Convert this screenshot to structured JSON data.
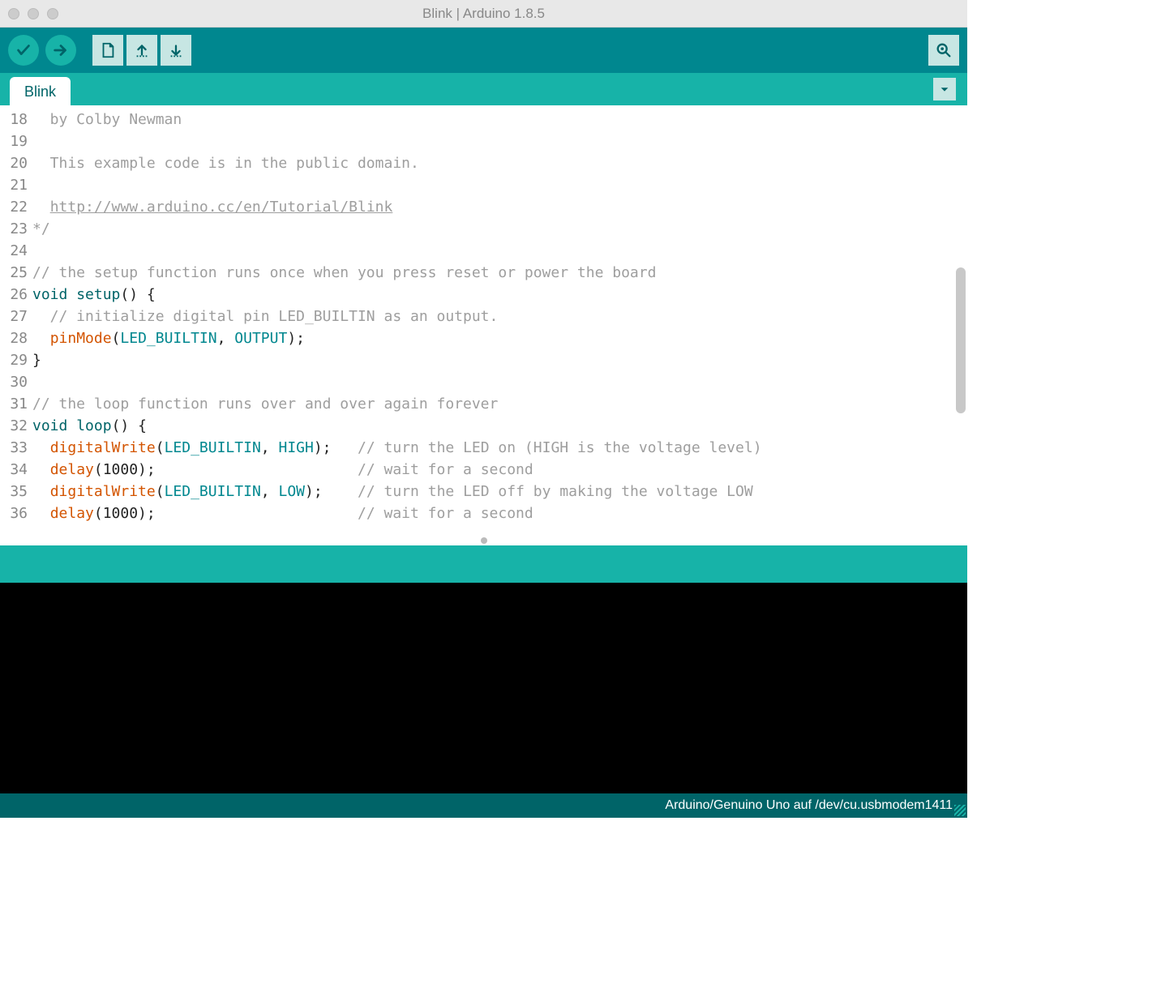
{
  "window": {
    "title": "Blink | Arduino 1.8.5"
  },
  "toolbar": {
    "verify": "Verify",
    "upload": "Upload",
    "new": "New",
    "open": "Open",
    "save": "Save",
    "serial": "Serial Monitor"
  },
  "tabs": {
    "active": "Blink"
  },
  "editor": {
    "first_line": 18,
    "lines": [
      {
        "n": 18,
        "tokens": [
          {
            "t": "  by Colby Newman",
            "c": "c-comment"
          }
        ]
      },
      {
        "n": 19,
        "tokens": []
      },
      {
        "n": 20,
        "tokens": [
          {
            "t": "  This example code is in the public domain.",
            "c": "c-comment"
          }
        ]
      },
      {
        "n": 21,
        "tokens": []
      },
      {
        "n": 22,
        "tokens": [
          {
            "t": "  ",
            "c": "c-comment"
          },
          {
            "t": "http://www.arduino.cc/en/Tutorial/Blink",
            "c": "c-link"
          }
        ]
      },
      {
        "n": 23,
        "tokens": [
          {
            "t": "*/",
            "c": "c-comment"
          }
        ]
      },
      {
        "n": 24,
        "tokens": []
      },
      {
        "n": 25,
        "tokens": [
          {
            "t": "// the setup function runs once when you press reset or power the board",
            "c": "c-comment"
          }
        ]
      },
      {
        "n": 26,
        "tokens": [
          {
            "t": "void",
            "c": "c-type"
          },
          {
            "t": " "
          },
          {
            "t": "setup",
            "c": "c-type"
          },
          {
            "t": "() {"
          }
        ]
      },
      {
        "n": 27,
        "tokens": [
          {
            "t": "  // initialize digital pin LED_BUILTIN as an output.",
            "c": "c-comment"
          }
        ]
      },
      {
        "n": 28,
        "tokens": [
          {
            "t": "  "
          },
          {
            "t": "pinMode",
            "c": "c-func"
          },
          {
            "t": "("
          },
          {
            "t": "LED_BUILTIN",
            "c": "c-const"
          },
          {
            "t": ", "
          },
          {
            "t": "OUTPUT",
            "c": "c-const"
          },
          {
            "t": ");"
          }
        ]
      },
      {
        "n": 29,
        "tokens": [
          {
            "t": "}"
          }
        ]
      },
      {
        "n": 30,
        "tokens": []
      },
      {
        "n": 31,
        "tokens": [
          {
            "t": "// the loop function runs over and over again forever",
            "c": "c-comment"
          }
        ]
      },
      {
        "n": 32,
        "tokens": [
          {
            "t": "void",
            "c": "c-type"
          },
          {
            "t": " "
          },
          {
            "t": "loop",
            "c": "c-type"
          },
          {
            "t": "() {"
          }
        ]
      },
      {
        "n": 33,
        "tokens": [
          {
            "t": "  "
          },
          {
            "t": "digitalWrite",
            "c": "c-func"
          },
          {
            "t": "("
          },
          {
            "t": "LED_BUILTIN",
            "c": "c-const"
          },
          {
            "t": ", "
          },
          {
            "t": "HIGH",
            "c": "c-const"
          },
          {
            "t": ");   "
          },
          {
            "t": "// turn the LED on (HIGH is the voltage level)",
            "c": "c-comment"
          }
        ]
      },
      {
        "n": 34,
        "tokens": [
          {
            "t": "  "
          },
          {
            "t": "delay",
            "c": "c-func"
          },
          {
            "t": "(1000);                       "
          },
          {
            "t": "// wait for a second",
            "c": "c-comment"
          }
        ]
      },
      {
        "n": 35,
        "tokens": [
          {
            "t": "  "
          },
          {
            "t": "digitalWrite",
            "c": "c-func"
          },
          {
            "t": "("
          },
          {
            "t": "LED_BUILTIN",
            "c": "c-const"
          },
          {
            "t": ", "
          },
          {
            "t": "LOW",
            "c": "c-const"
          },
          {
            "t": ");    "
          },
          {
            "t": "// turn the LED off by making the voltage LOW",
            "c": "c-comment"
          }
        ]
      },
      {
        "n": 36,
        "tokens": [
          {
            "t": "  "
          },
          {
            "t": "delay",
            "c": "c-func"
          },
          {
            "t": "(1000);                       "
          },
          {
            "t": "// wait for a second",
            "c": "c-comment"
          }
        ]
      }
    ]
  },
  "footer": {
    "board": "Arduino/Genuino Uno auf /dev/cu.usbmodem1411"
  }
}
